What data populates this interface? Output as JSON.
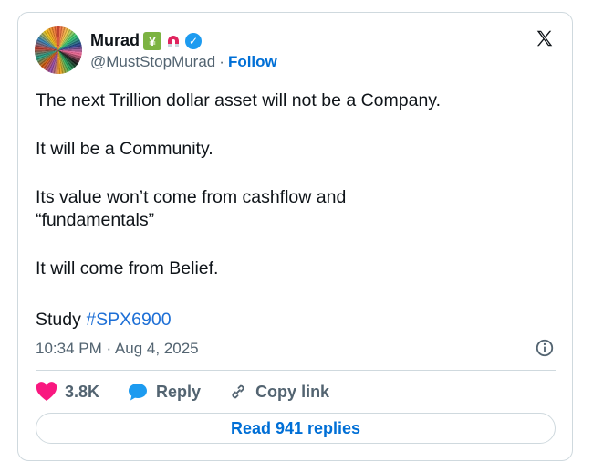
{
  "author": {
    "name": "Murad",
    "handle": "@MustStopMurad",
    "separator": "·",
    "follow_label": "Follow",
    "verified_icon": "verified-badge-icon",
    "emoji": [
      "money-emoji",
      "magnet-emoji"
    ]
  },
  "tweet": {
    "paragraphs": [
      "The next Trillion dollar asset will not be a Company.",
      "It will be a Community.",
      "Its value won’t come from cashflow and “fundamentals”",
      "It will come from Belief."
    ],
    "study_prefix": "Study ",
    "hashtag": "#SPX6900",
    "timestamp": "10:34 PM · Aug 4, 2025"
  },
  "actions": {
    "like_count": "3.8K",
    "reply_label": "Reply",
    "copy_link_label": "Copy link"
  },
  "read_replies_label": "Read 941 replies",
  "colors": {
    "accent": "#1d9bf0",
    "link": "#006fd6",
    "like": "#f91880",
    "muted": "#536471",
    "border": "#cfd9de"
  }
}
